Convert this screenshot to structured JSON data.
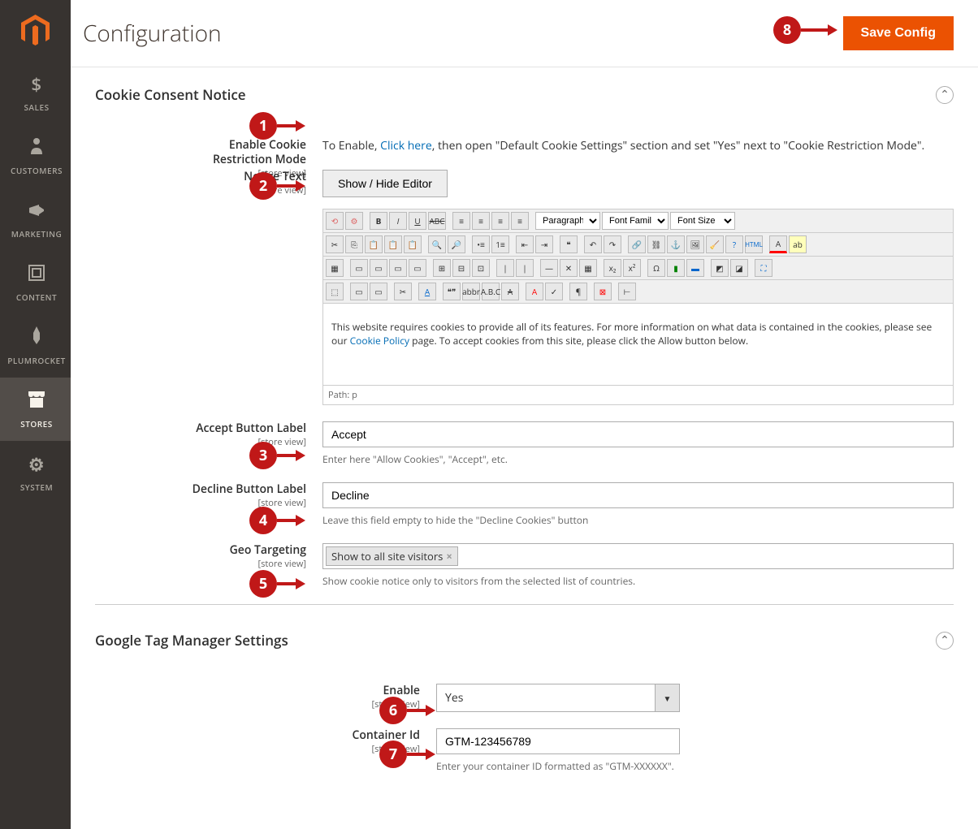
{
  "page_title": "Configuration",
  "save_button": "Save Config",
  "sidebar": {
    "items": [
      {
        "label": "SALES",
        "icon": "$"
      },
      {
        "label": "CUSTOMERS",
        "icon": "user"
      },
      {
        "label": "MARKETING",
        "icon": "megaphone"
      },
      {
        "label": "CONTENT",
        "icon": "blocks"
      },
      {
        "label": "PLUMROCKET",
        "icon": "rocket"
      },
      {
        "label": "STORES",
        "icon": "store"
      },
      {
        "label": "SYSTEM",
        "icon": "gear"
      }
    ],
    "active": "STORES"
  },
  "sections": {
    "cookie": {
      "title": "Cookie Consent Notice",
      "fields": {
        "enable_restriction": {
          "label": "Enable Cookie Restriction Mode",
          "scope": "[store view]",
          "desc_prefix": "To Enable, ",
          "desc_link": "Click here",
          "desc_suffix": ", then open \"Default Cookie Settings\" section and set \"Yes\" next to \"Cookie Restriction Mode\"."
        },
        "notice_text": {
          "label": "Notice Text",
          "scope": "[store view]",
          "toggle_btn": "Show / Hide Editor",
          "toolbar_selects": {
            "format": "Paragraph",
            "font_family": "Font Family",
            "font_size": "Font Size"
          },
          "body_prefix": "This website requires cookies to provide all of its features. For more information on what data is contained in the cookies, please see our ",
          "body_link": "Cookie Policy",
          "body_suffix": " page. To accept cookies from this site, please click the Allow button below.",
          "path": "Path: p"
        },
        "accept_btn": {
          "label": "Accept Button Label",
          "scope": "[store view]",
          "value": "Accept",
          "help": "Enter here \"Allow Cookies\", \"Accept\", etc."
        },
        "decline_btn": {
          "label": "Decline Button Label",
          "scope": "[store view]",
          "value": "Decline",
          "help": "Leave this field empty to hide the \"Decline Cookies\" button"
        },
        "geo": {
          "label": "Geo Targeting",
          "scope": "[store view]",
          "tag": "Show to all site visitors",
          "help": "Show cookie notice only to visitors from the selected list of countries."
        }
      }
    },
    "gtm": {
      "title": "Google Tag Manager Settings",
      "fields": {
        "enable": {
          "label": "Enable",
          "scope": "[store view]",
          "value": "Yes"
        },
        "container": {
          "label": "Container Id",
          "scope": "[store view]",
          "value": "GTM-123456789",
          "help": "Enter your container ID formatted as \"GTM-XXXXXX\"."
        }
      }
    }
  },
  "annotations": {
    "b1": "1",
    "b2": "2",
    "b3": "3",
    "b4": "4",
    "b5": "5",
    "b6": "6",
    "b7": "7",
    "b8": "8"
  }
}
